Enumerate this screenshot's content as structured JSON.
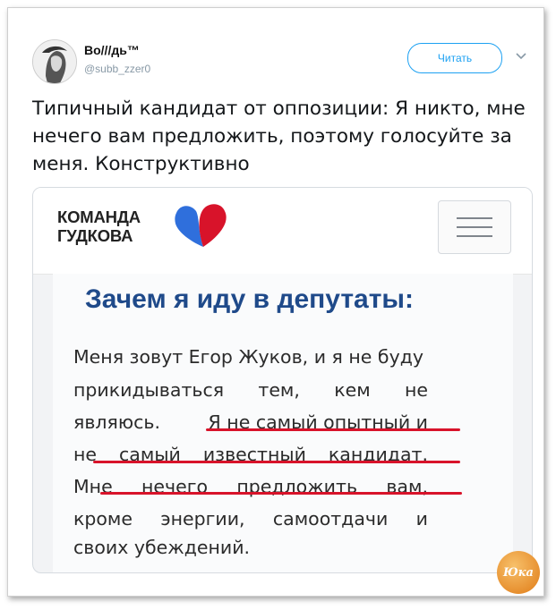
{
  "tweet": {
    "display_name": "Во///дь™",
    "handle": "@subb_zzer0",
    "follow_label": "Читать",
    "text": "Типичный кандидат от оппозиции: Я никто, мне нечего вам предложить, поэтому голосуйте за меня. Конструктивно"
  },
  "card": {
    "logo_line1": "КОМАНДА",
    "logo_line2": "ГУДКОВА",
    "heading": "Зачем я иду в депутаты:",
    "lines": [
      [
        "Меня зовут Егор Жуков, и я не буду"
      ],
      [
        "прикидываться",
        "тем,",
        "кем",
        "не"
      ],
      [
        "являюсь.",
        "Я не самый опытный и"
      ],
      [
        "не",
        "самый",
        "известный",
        "кандидат."
      ],
      [
        "Мне",
        "нечего",
        "предложить",
        "вам,"
      ],
      [
        "кроме",
        "энергии,",
        "самоотдачи",
        "и"
      ],
      [
        "своих убеждений."
      ]
    ]
  },
  "watermark": "Юка",
  "colors": {
    "accent": "#1da1f2",
    "heading": "#1f4a8a",
    "underline": "#d8132a",
    "heart_blue": "#2f6fdc",
    "heart_red": "#d8132a"
  }
}
